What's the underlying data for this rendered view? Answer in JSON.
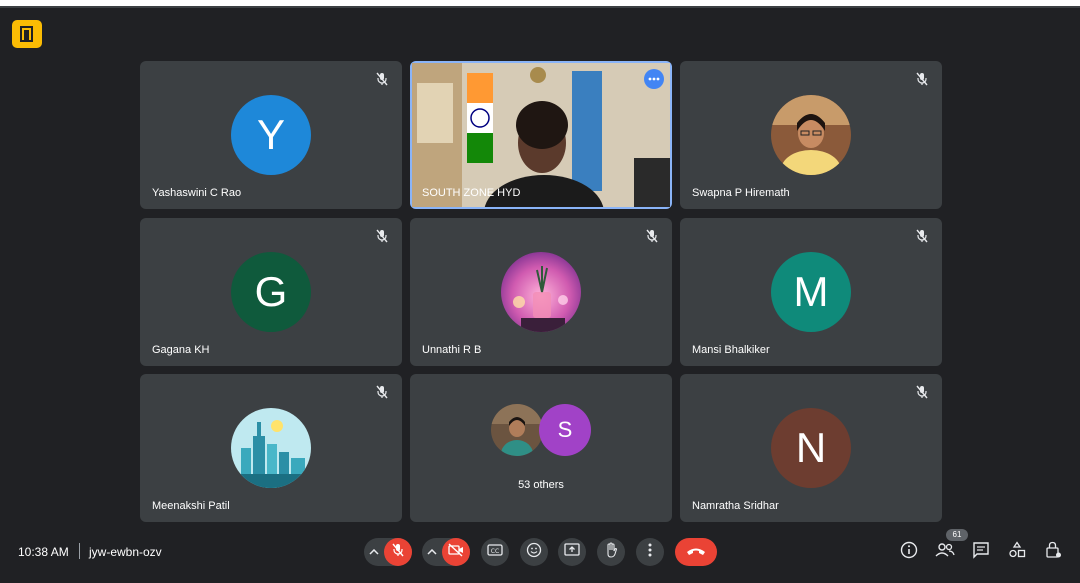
{
  "colors": {
    "background": "#202124",
    "tile": "#3c4043",
    "active_border": "#8ab4f8",
    "danger": "#ea4335",
    "corner_icon": "#fbbc04"
  },
  "participants": [
    {
      "name": "Yashaswini C Rao",
      "initial": "Y",
      "avatar_color": "#1e88d9",
      "muted": true
    },
    {
      "name": "SOUTH ZONE HYD",
      "initial": "",
      "avatar_color": "",
      "muted": false,
      "video_on": true,
      "pinned_active": true
    },
    {
      "name": "Swapna P Hiremath",
      "initial": "",
      "avatar_color": "#d8b47a",
      "muted": true,
      "photo": true
    },
    {
      "name": "Gagana KH",
      "initial": "G",
      "avatar_color": "#0f5a3c",
      "muted": true
    },
    {
      "name": "Unnathi R B",
      "initial": "",
      "avatar_color": "#c85fa0",
      "muted": true,
      "photo": true
    },
    {
      "name": "Mansi Bhalkiker",
      "initial": "M",
      "avatar_color": "#0f8a7a",
      "muted": true
    },
    {
      "name": "Meenakshi Patil",
      "initial": "",
      "avatar_color": "#5cc6d6",
      "muted": true,
      "photo": true
    },
    {
      "name": "Namratha Sridhar",
      "initial": "N",
      "avatar_color": "#6d3d30",
      "muted": true
    }
  ],
  "others_tile": {
    "label": "53 others",
    "avatar_initial": "S",
    "avatar_color": "#a142c7"
  },
  "bottom_bar": {
    "time": "10:38 AM",
    "meeting_code": "jyw-ewbn-ozv",
    "people_count": "61"
  },
  "icons": {
    "corner": "exit-door-icon",
    "mic": "mic-off-icon",
    "camera": "camera-off-icon",
    "captions": "captions-icon",
    "emoji": "emoji-icon",
    "present": "present-screen-icon",
    "raise_hand": "raise-hand-icon",
    "more": "more-vert-icon",
    "leave": "call-end-icon",
    "info": "info-icon",
    "people": "people-icon",
    "chat": "chat-icon",
    "activities": "activities-icon",
    "host_controls": "lock-person-icon"
  }
}
